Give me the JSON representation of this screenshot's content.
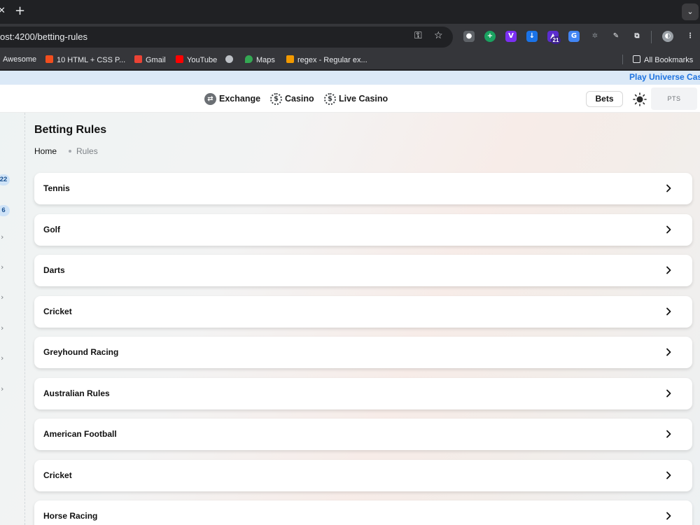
{
  "browser": {
    "url": "ost:4200/betting-rules",
    "bookmarks": [
      "Awesome",
      "10 HTML + CSS P...",
      "Gmail",
      "YouTube",
      "Maps",
      "regex - Regular ex...",
      "All Bookmarks"
    ],
    "extension_badge": "21"
  },
  "promo": {
    "text": "Play Universe Cas"
  },
  "nav": {
    "items": [
      {
        "label": "Exchange",
        "icon": "exchange-icon"
      },
      {
        "label": "Casino",
        "icon": "poker-chip-icon"
      },
      {
        "label": "Live Casino",
        "icon": "poker-chip-icon"
      }
    ],
    "bets_label": "Bets",
    "pts_label": "PTS"
  },
  "sidebar": {
    "badges": [
      "22",
      "6"
    ]
  },
  "page": {
    "title": "Betting Rules",
    "breadcrumb": {
      "home": "Home",
      "current": "Rules"
    }
  },
  "rules": [
    "Tennis",
    "Golf",
    "Darts",
    "Cricket",
    "Greyhound Racing",
    "Australian Rules",
    "American Football",
    "Cricket",
    "Horse Racing"
  ],
  "colors": {
    "promo_text": "#1e73e0",
    "promo_bg": "#dbe9f7",
    "badge_bg": "#cfe3f7"
  }
}
